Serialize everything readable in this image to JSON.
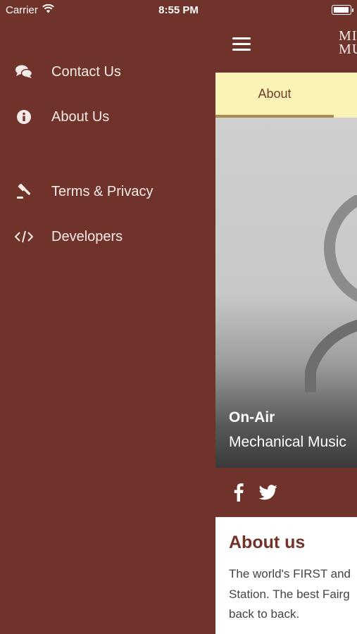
{
  "status_bar": {
    "carrier": "Carrier",
    "time": "8:55 PM",
    "battery_level": 1.0
  },
  "menu": {
    "items": [
      {
        "label": "Contact Us",
        "icon": "chat-bubbles-icon"
      },
      {
        "label": "About Us",
        "icon": "info-circle-icon"
      },
      {
        "label": "Terms & Privacy",
        "icon": "gavel-icon"
      },
      {
        "label": "Developers",
        "icon": "code-icon"
      }
    ]
  },
  "header": {
    "logo_line1": "MI",
    "logo_line2": "MU"
  },
  "tabs": [
    {
      "label": "About",
      "active": true
    }
  ],
  "player": {
    "status": "On-Air",
    "station": "Mechanical Music"
  },
  "social": [
    {
      "icon": "facebook-icon"
    },
    {
      "icon": "twitter-icon"
    }
  ],
  "about": {
    "title": "About us",
    "lines": [
      "The world's FIRST and",
      "Station. The best Fairg",
      "back to back."
    ]
  },
  "colors": {
    "background": "#70332b",
    "tab_bg": "#fbf2b5",
    "tab_text": "#6d3f2c",
    "tab_indicator": "#a88a52",
    "title": "#71332a"
  }
}
